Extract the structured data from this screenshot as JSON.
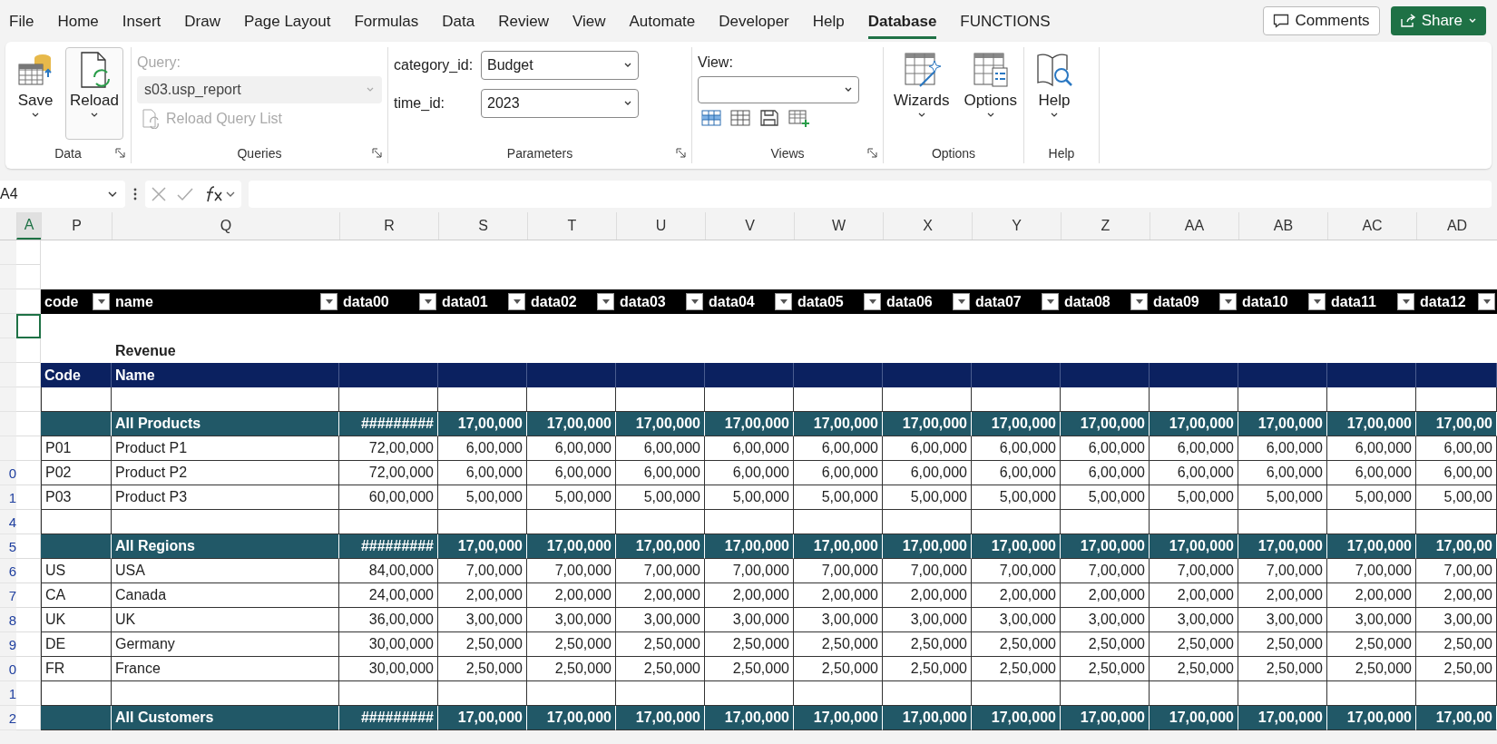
{
  "tabs": [
    {
      "label": "File",
      "selected": false
    },
    {
      "label": "Home",
      "selected": false
    },
    {
      "label": "Insert",
      "selected": false
    },
    {
      "label": "Draw",
      "selected": false
    },
    {
      "label": "Page Layout",
      "selected": false
    },
    {
      "label": "Formulas",
      "selected": false
    },
    {
      "label": "Data",
      "selected": false
    },
    {
      "label": "Review",
      "selected": false
    },
    {
      "label": "View",
      "selected": false
    },
    {
      "label": "Automate",
      "selected": false
    },
    {
      "label": "Developer",
      "selected": false
    },
    {
      "label": "Help",
      "selected": false
    },
    {
      "label": "Database",
      "selected": true
    },
    {
      "label": "FUNCTIONS",
      "selected": false
    }
  ],
  "actions": {
    "comments": "Comments",
    "share": "Share"
  },
  "ribbon": {
    "data_group": {
      "label": "Data",
      "save": "Save",
      "reload": "Reload",
      "reload_pressed": true
    },
    "queries_group": {
      "label": "Queries",
      "query_label": "Query:",
      "query_value": "s03.usp_report",
      "disabled": true,
      "reload_list": "Reload Query List"
    },
    "parameters_group": {
      "label": "Parameters",
      "params": [
        {
          "name": "category_id:",
          "value": "Budget"
        },
        {
          "name": "time_id:",
          "value": "2023"
        }
      ]
    },
    "views_group": {
      "label": "Views",
      "view_label": "View:"
    },
    "options_group": {
      "label": "Options",
      "wizards": "Wizards",
      "options": "Options"
    },
    "help_group": {
      "label": "Help",
      "help": "Help"
    }
  },
  "formula_bar": {
    "name_box": "A4"
  },
  "grid": {
    "columns": [
      {
        "label": "A",
        "selected": true
      },
      {
        "label": "P",
        "selected": false
      },
      {
        "label": "Q",
        "selected": false
      },
      {
        "label": "R",
        "selected": false
      },
      {
        "label": "S",
        "selected": false
      },
      {
        "label": "T",
        "selected": false
      },
      {
        "label": "U",
        "selected": false
      },
      {
        "label": "V",
        "selected": false
      },
      {
        "label": "W",
        "selected": false
      },
      {
        "label": "X",
        "selected": false
      },
      {
        "label": "Y",
        "selected": false
      },
      {
        "label": "Z",
        "selected": false
      },
      {
        "label": "AA",
        "selected": false
      },
      {
        "label": "AB",
        "selected": false
      },
      {
        "label": "AC",
        "selected": false
      },
      {
        "label": "AD",
        "selected": false
      }
    ],
    "rows": [
      {
        "kind": "empty",
        "selected": false
      },
      {
        "kind": "empty",
        "selected": false
      },
      {
        "kind": "filter_header",
        "selected": false,
        "code": "code",
        "name": "name",
        "values": [
          "data00",
          "data01",
          "data02",
          "data03",
          "data04",
          "data05",
          "data06",
          "data07",
          "data08",
          "data09",
          "data10",
          "data11",
          "data12"
        ]
      },
      {
        "kind": "empty",
        "selected": true
      },
      {
        "kind": "title",
        "selected": false,
        "name": "Revenue"
      },
      {
        "kind": "band",
        "selected": false,
        "code": "Code",
        "name": "Name"
      },
      {
        "kind": "spacer",
        "selected": false
      },
      {
        "kind": "total",
        "selected": false,
        "name": "All Products",
        "values": [
          "#########",
          "17,00,000",
          "17,00,000",
          "17,00,000",
          "17,00,000",
          "17,00,000",
          "17,00,000",
          "17,00,000",
          "17,00,000",
          "17,00,000",
          "17,00,000",
          "17,00,000",
          "17,00,00"
        ]
      },
      {
        "kind": "item",
        "selected": false,
        "code": "P01",
        "name": "Product P1",
        "values": [
          "72,00,000",
          "6,00,000",
          "6,00,000",
          "6,00,000",
          "6,00,000",
          "6,00,000",
          "6,00,000",
          "6,00,000",
          "6,00,000",
          "6,00,000",
          "6,00,000",
          "6,00,000",
          "6,00,00"
        ]
      },
      {
        "kind": "item",
        "selected": false,
        "row_number": "0",
        "code": "P02",
        "name": "Product P2",
        "values": [
          "72,00,000",
          "6,00,000",
          "6,00,000",
          "6,00,000",
          "6,00,000",
          "6,00,000",
          "6,00,000",
          "6,00,000",
          "6,00,000",
          "6,00,000",
          "6,00,000",
          "6,00,000",
          "6,00,00"
        ]
      },
      {
        "kind": "item",
        "selected": false,
        "row_number": "1",
        "code": "P03",
        "name": "Product P3",
        "values": [
          "60,00,000",
          "5,00,000",
          "5,00,000",
          "5,00,000",
          "5,00,000",
          "5,00,000",
          "5,00,000",
          "5,00,000",
          "5,00,000",
          "5,00,000",
          "5,00,000",
          "5,00,000",
          "5,00,00"
        ]
      },
      {
        "kind": "spacer",
        "selected": false,
        "row_number": "4"
      },
      {
        "kind": "total",
        "selected": false,
        "row_number": "5",
        "name": "All Regions",
        "values": [
          "#########",
          "17,00,000",
          "17,00,000",
          "17,00,000",
          "17,00,000",
          "17,00,000",
          "17,00,000",
          "17,00,000",
          "17,00,000",
          "17,00,000",
          "17,00,000",
          "17,00,000",
          "17,00,00"
        ]
      },
      {
        "kind": "item",
        "selected": false,
        "row_number": "6",
        "code": "US",
        "name": "USA",
        "values": [
          "84,00,000",
          "7,00,000",
          "7,00,000",
          "7,00,000",
          "7,00,000",
          "7,00,000",
          "7,00,000",
          "7,00,000",
          "7,00,000",
          "7,00,000",
          "7,00,000",
          "7,00,000",
          "7,00,00"
        ]
      },
      {
        "kind": "item",
        "selected": false,
        "row_number": "7",
        "code": "CA",
        "name": "Canada",
        "values": [
          "24,00,000",
          "2,00,000",
          "2,00,000",
          "2,00,000",
          "2,00,000",
          "2,00,000",
          "2,00,000",
          "2,00,000",
          "2,00,000",
          "2,00,000",
          "2,00,000",
          "2,00,000",
          "2,00,00"
        ]
      },
      {
        "kind": "item",
        "selected": false,
        "row_number": "8",
        "code": "UK",
        "name": "UK",
        "values": [
          "36,00,000",
          "3,00,000",
          "3,00,000",
          "3,00,000",
          "3,00,000",
          "3,00,000",
          "3,00,000",
          "3,00,000",
          "3,00,000",
          "3,00,000",
          "3,00,000",
          "3,00,000",
          "3,00,00"
        ]
      },
      {
        "kind": "item",
        "selected": false,
        "row_number": "9",
        "code": "DE",
        "name": "Germany",
        "values": [
          "30,00,000",
          "2,50,000",
          "2,50,000",
          "2,50,000",
          "2,50,000",
          "2,50,000",
          "2,50,000",
          "2,50,000",
          "2,50,000",
          "2,50,000",
          "2,50,000",
          "2,50,000",
          "2,50,00"
        ]
      },
      {
        "kind": "item",
        "selected": false,
        "row_number": "0",
        "code": "FR",
        "name": "France",
        "values": [
          "30,00,000",
          "2,50,000",
          "2,50,000",
          "2,50,000",
          "2,50,000",
          "2,50,000",
          "2,50,000",
          "2,50,000",
          "2,50,000",
          "2,50,000",
          "2,50,000",
          "2,50,000",
          "2,50,00"
        ]
      },
      {
        "kind": "spacer",
        "selected": false,
        "row_number": "1"
      },
      {
        "kind": "total",
        "selected": false,
        "row_number": "2",
        "name": "All Customers",
        "values": [
          "#########",
          "17,00,000",
          "17,00,000",
          "17,00,000",
          "17,00,000",
          "17,00,000",
          "17,00,000",
          "17,00,000",
          "17,00,000",
          "17,00,000",
          "17,00,000",
          "17,00,000",
          "17,00,00"
        ]
      }
    ]
  }
}
